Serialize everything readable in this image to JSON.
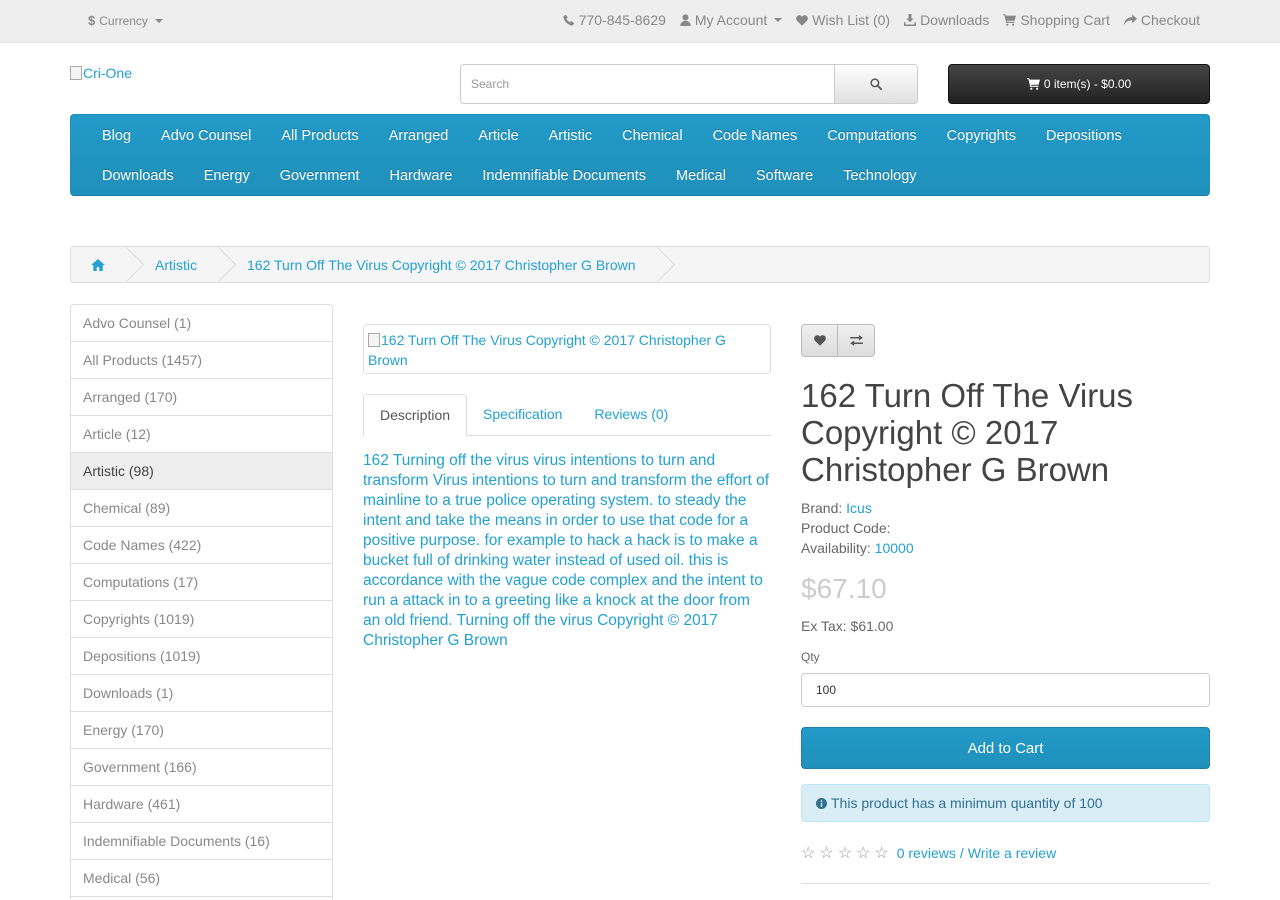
{
  "topbar": {
    "currency_label": "Currency",
    "links": {
      "phone": "770-845-8629",
      "account": "My Account",
      "wishlist": "Wish List (0)",
      "downloads": "Downloads",
      "cart": "Shopping Cart",
      "checkout": "Checkout"
    }
  },
  "header": {
    "logo_alt": "Cri-One",
    "search_placeholder": "Search",
    "cart_summary": "0 item(s) - $0.00"
  },
  "menu": {
    "row1": [
      "Blog",
      "Advo Counsel",
      "All Products",
      "Arranged",
      "Article",
      "Artistic",
      "Chemical",
      "Code Names",
      "Computations",
      "Copyrights",
      "Depositions"
    ],
    "row2": [
      "Downloads",
      "Energy",
      "Government",
      "Hardware",
      "Indemnifiable Documents",
      "Medical",
      "Software",
      "Technology"
    ]
  },
  "breadcrumb": {
    "category": "Artistic",
    "product": "162 Turn Off The Virus Copyright © 2017 Christopher G Brown"
  },
  "sidebar": {
    "items": [
      "Advo Counsel (1)",
      "All Products (1457)",
      "Arranged (170)",
      "Article (12)",
      "Artistic (98)",
      "Chemical (89)",
      "Code Names (422)",
      "Computations (17)",
      "Copyrights (1019)",
      "Depositions (1019)",
      "Downloads (1)",
      "Energy (170)",
      "Government (166)",
      "Hardware (461)",
      "Indemnifiable Documents (16)",
      "Medical (56)"
    ],
    "active_index": 4
  },
  "product": {
    "image_alt": "162 Turn Off The Virus Copyright © 2017 Christopher G Brown",
    "tabs": [
      "Description",
      "Specification",
      "Reviews (0)"
    ],
    "description": "162 Turning off the virus virus intentions to turn and transform Virus intentions to turn and transform the effort of mainline to a true police operating system. to steady the intent and take the means in order to use that code for a positive purpose. for example to hack a hack is to make a bucket full of drinking water instead of used oil. this is accordance with the vague code complex and the intent to run a attack in to a greeting like a knock at the door from an old friend. Turning off the virus Copyright © 2017 Christopher G Brown",
    "title": "162 Turn Off The Virus Copyright © 2017 Christopher G Brown",
    "brand_label": "Brand:",
    "brand": "Icus",
    "code_label": "Product Code:",
    "code": "",
    "availability_label": "Availability:",
    "availability": "10000",
    "price": "$67.10",
    "extax_label": "Ex Tax:",
    "extax": "$61.00",
    "qty_label": "Qty",
    "qty_value": "100",
    "add_to_cart": "Add to Cart",
    "min_qty_notice": "This product has a minimum quantity of 100",
    "reviews_link": "0 reviews",
    "write_review": "Write a review",
    "rating_stars": 0
  },
  "colors": {
    "brand_blue": "#229ac8",
    "link": "#23a1d1",
    "cart_dark": "#303030",
    "alert_bg": "#d9edf7"
  }
}
